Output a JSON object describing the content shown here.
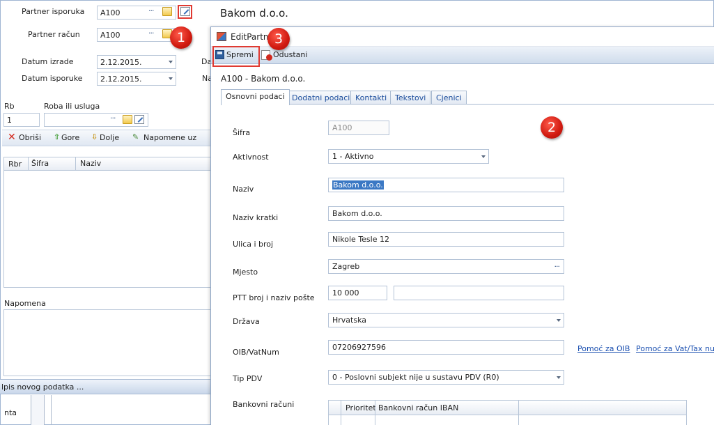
{
  "main_form": {
    "title": "Bakom d.o.o.",
    "fields": [
      {
        "label": "Partner isporuka",
        "value": "A100"
      },
      {
        "label": "Partner račun",
        "value": "A100"
      },
      {
        "label": "Datum izrade",
        "value": "2.12.2015."
      },
      {
        "label": "Datum isporuke",
        "value": "2.12.2015."
      }
    ],
    "truncated_labels": [
      "Da",
      "Na"
    ],
    "items_header": {
      "rb_label": "Rb",
      "item_label": "Roba ili usluga",
      "rb_value": "1"
    },
    "toolbar": {
      "delete": "Obriši",
      "up": "Gore",
      "down": "Dolje",
      "notes": "Napomene uz"
    },
    "grid_columns": [
      "Rbr",
      "Šifra",
      "Naziv"
    ],
    "note_label": "Napomena",
    "new_entry": "lpis novog podatka ...",
    "bottom_text": "nta"
  },
  "dialog": {
    "title": "EditPartne",
    "save_label": "Spremi",
    "cancel_label": "Odustani",
    "heading": "A100 - Bakom d.o.o.",
    "tabs": [
      "Osnovni podaci",
      "Dodatni podaci",
      "Kontakti",
      "Tekstovi",
      "Cjenici"
    ],
    "fields": {
      "sifra": {
        "label": "Šifra",
        "value": "A100"
      },
      "aktivnost": {
        "label": "Aktivnost",
        "value": "1 - Aktivno"
      },
      "naziv": {
        "label": "Naziv",
        "value": "Bakom d.o.o."
      },
      "naziv_kratki": {
        "label": "Naziv kratki",
        "value": "Bakom d.o.o."
      },
      "ulica": {
        "label": "Ulica i broj",
        "value": "Nikole Tesle 12"
      },
      "mjesto": {
        "label": "Mjesto",
        "value": "Zagreb"
      },
      "ptt": {
        "label": "PTT broj i naziv pošte",
        "value": "10 000",
        "name_value": ""
      },
      "drzava": {
        "label": "Država",
        "value": "Hrvatska"
      },
      "oib": {
        "label": "OIB/VatNum",
        "value": "07206927596"
      },
      "tip_pdv": {
        "label": "Tip PDV",
        "value": "0 - Poslovni subjekt nije u sustavu PDV (R0)"
      },
      "bankovni": {
        "label": "Bankovni računi"
      }
    },
    "links": {
      "oib_help": "Pomoć za OIB",
      "vat_help": "Pomoć za Vat/Tax num"
    },
    "bank_columns": [
      "Prioritet",
      "Bankovni račun IBAN"
    ]
  },
  "callouts": [
    "1",
    "2",
    "3"
  ],
  "colors": {
    "accent": "#e03a32",
    "link": "#1a4fb0",
    "selection": "#3b78c4"
  }
}
